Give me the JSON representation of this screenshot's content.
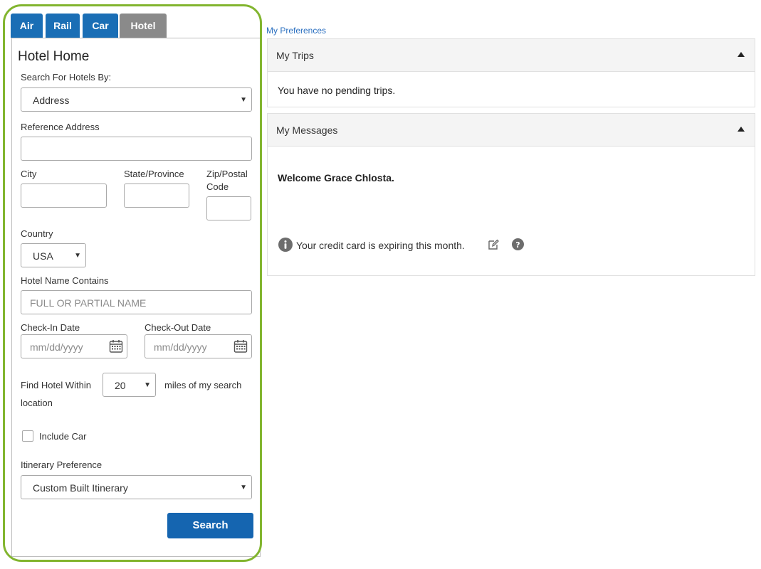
{
  "tabs": [
    {
      "label": "Air"
    },
    {
      "label": "Rail"
    },
    {
      "label": "Car"
    },
    {
      "label": "Hotel"
    }
  ],
  "hotel": {
    "title": "Hotel Home",
    "search_by_label": "Search For Hotels By:",
    "search_by_value": "Address",
    "reference_address_label": "Reference Address",
    "reference_address_value": "",
    "city_label": "City",
    "state_label": "State/Province",
    "zip_label_line1": "Zip/Postal",
    "zip_label_line2": "Code",
    "country_label": "Country",
    "country_value": "USA",
    "hotel_name_label": "Hotel Name Contains",
    "hotel_name_placeholder": "FULL OR PARTIAL NAME",
    "checkin_label": "Check-In Date",
    "checkin_placeholder": "mm/dd/yyyy",
    "checkout_label": "Check-Out Date",
    "checkout_placeholder": "mm/dd/yyyy",
    "within_label": "Find Hotel Within",
    "within_value": "20",
    "within_suffix": "miles of my search",
    "within_suffix2": "location",
    "include_car_label": "Include Car",
    "include_car_checked": false,
    "itinerary_label": "Itinerary Preference",
    "itinerary_value": "Custom Built Itinerary",
    "search_button": "Search"
  },
  "right": {
    "preferences_link": "My Preferences",
    "trips_title": "My Trips",
    "trips_message": "You have no pending trips.",
    "messages_title": "My Messages",
    "welcome": "Welcome Grace Chlosta.",
    "credit_card_notice": "Your credit card is expiring this month."
  },
  "colors": {
    "tab_blue": "#1a6eb5",
    "tab_active": "#8a8a8a",
    "search_button": "#1565b0",
    "highlight_outline": "#82b52f",
    "link": "#2a6fc0"
  }
}
